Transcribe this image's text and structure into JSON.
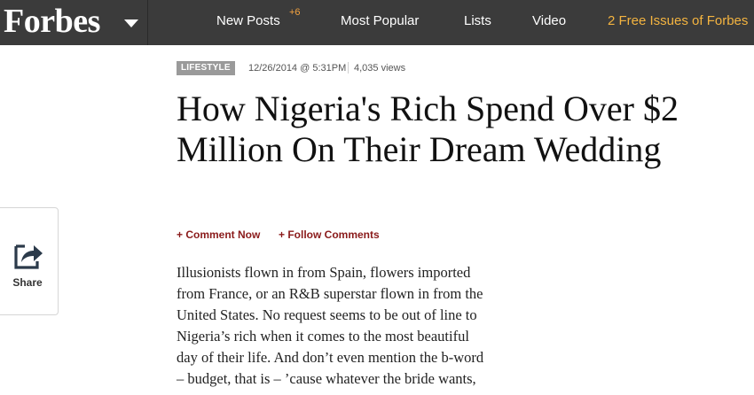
{
  "header": {
    "logo": "Forbes",
    "nav": {
      "new_posts": "New Posts",
      "new_posts_badge": "+6",
      "most_popular": "Most Popular",
      "lists": "Lists",
      "video": "Video",
      "promo": "2 Free Issues of Forbes"
    }
  },
  "article": {
    "category": "LIFESTYLE",
    "timestamp": "12/26/2014 @ 5:31PM",
    "views": "4,035 views",
    "headline": "How Nigeria's Rich Spend Over $2 Million On Their Dream Wedding",
    "comment_label": "+ Comment Now",
    "follow_label": "+ Follow Comments",
    "body_lines": [
      "Illusionists flown in from Spain, flowers imported",
      "from France, or an R&B superstar flown in from the",
      "United States. No request seems to be out of line to",
      "Nigeria’s rich when it comes to the most beautiful",
      "day of their life. And don’t even mention the b-word",
      "– budget, that is – ’cause whatever the bride wants,"
    ]
  },
  "share": {
    "label": "Share",
    "icon": "share-arrow-icon"
  },
  "colors": {
    "topbar": "#3b3b3b",
    "promo": "#f4b440",
    "badge": "#f4a340",
    "category_bg": "#9a9a9a",
    "action_link": "#8a1a1a"
  }
}
